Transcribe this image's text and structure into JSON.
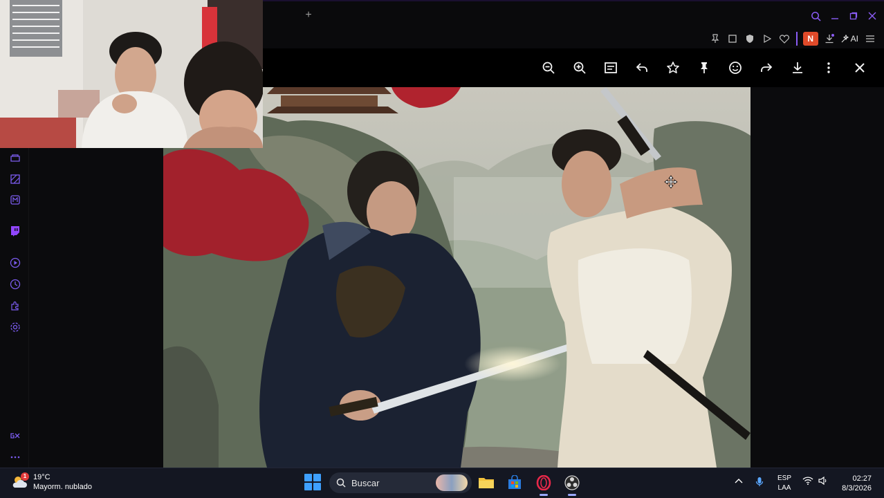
{
  "browser": {
    "new_tab": "+",
    "ext_n_badge": "N",
    "ai_label": "AI"
  },
  "weather": {
    "badge": "1",
    "temperature": "19°C",
    "condition": "Mayorm. nublado"
  },
  "taskbar": {
    "search_label": "Buscar"
  },
  "tray": {
    "lang_line1": "ESP",
    "lang_line2": "LAA",
    "time": "02:27",
    "date": "8/3/2026"
  },
  "colors": {
    "accent": "#8b5cf6",
    "twitch": "#9146ff",
    "badge_red": "#e04a2a"
  }
}
